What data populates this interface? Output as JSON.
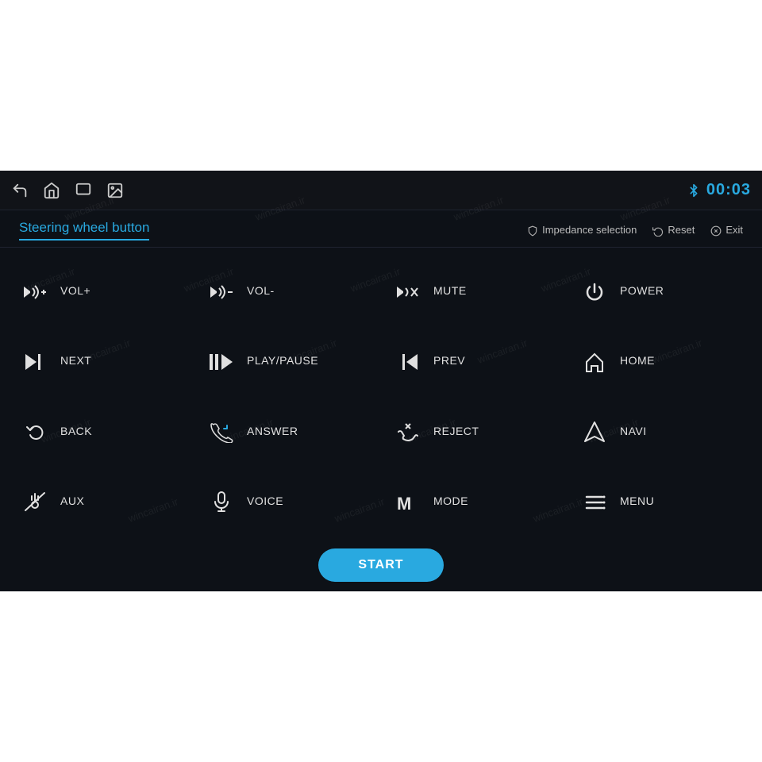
{
  "topBar": {
    "clock": "00:03",
    "bluetoothIcon": "bluetooth",
    "navIcons": [
      "back-icon",
      "home-icon",
      "window-icon",
      "image-icon"
    ]
  },
  "header": {
    "title": "Steering wheel button",
    "actions": [
      {
        "icon": "shield-icon",
        "label": "Impedance selection"
      },
      {
        "icon": "reset-icon",
        "label": "Reset"
      },
      {
        "icon": "exit-icon",
        "label": "Exit"
      }
    ]
  },
  "buttons": [
    {
      "id": "vol-plus",
      "label": "VOL+",
      "icon": "vol-plus"
    },
    {
      "id": "vol-minus",
      "label": "VOL-",
      "icon": "vol-minus"
    },
    {
      "id": "mute",
      "label": "MUTE",
      "icon": "mute"
    },
    {
      "id": "power",
      "label": "POWER",
      "icon": "power"
    },
    {
      "id": "next",
      "label": "NEXT",
      "icon": "next"
    },
    {
      "id": "play-pause",
      "label": "PLAY/PAUSE",
      "icon": "play-pause"
    },
    {
      "id": "prev",
      "label": "PREV",
      "icon": "prev"
    },
    {
      "id": "home",
      "label": "HOME",
      "icon": "home"
    },
    {
      "id": "back",
      "label": "BACK",
      "icon": "back"
    },
    {
      "id": "answer",
      "label": "ANSWER",
      "icon": "answer"
    },
    {
      "id": "reject",
      "label": "REJECT",
      "icon": "reject"
    },
    {
      "id": "navi",
      "label": "NAVI",
      "icon": "navi"
    },
    {
      "id": "aux",
      "label": "AUX",
      "icon": "aux"
    },
    {
      "id": "voice",
      "label": "VOICE",
      "icon": "voice"
    },
    {
      "id": "mode",
      "label": "MODE",
      "icon": "mode"
    },
    {
      "id": "menu",
      "label": "MENU",
      "icon": "menu"
    }
  ],
  "startButton": {
    "label": "START"
  },
  "watermark": "wincairan.ir"
}
